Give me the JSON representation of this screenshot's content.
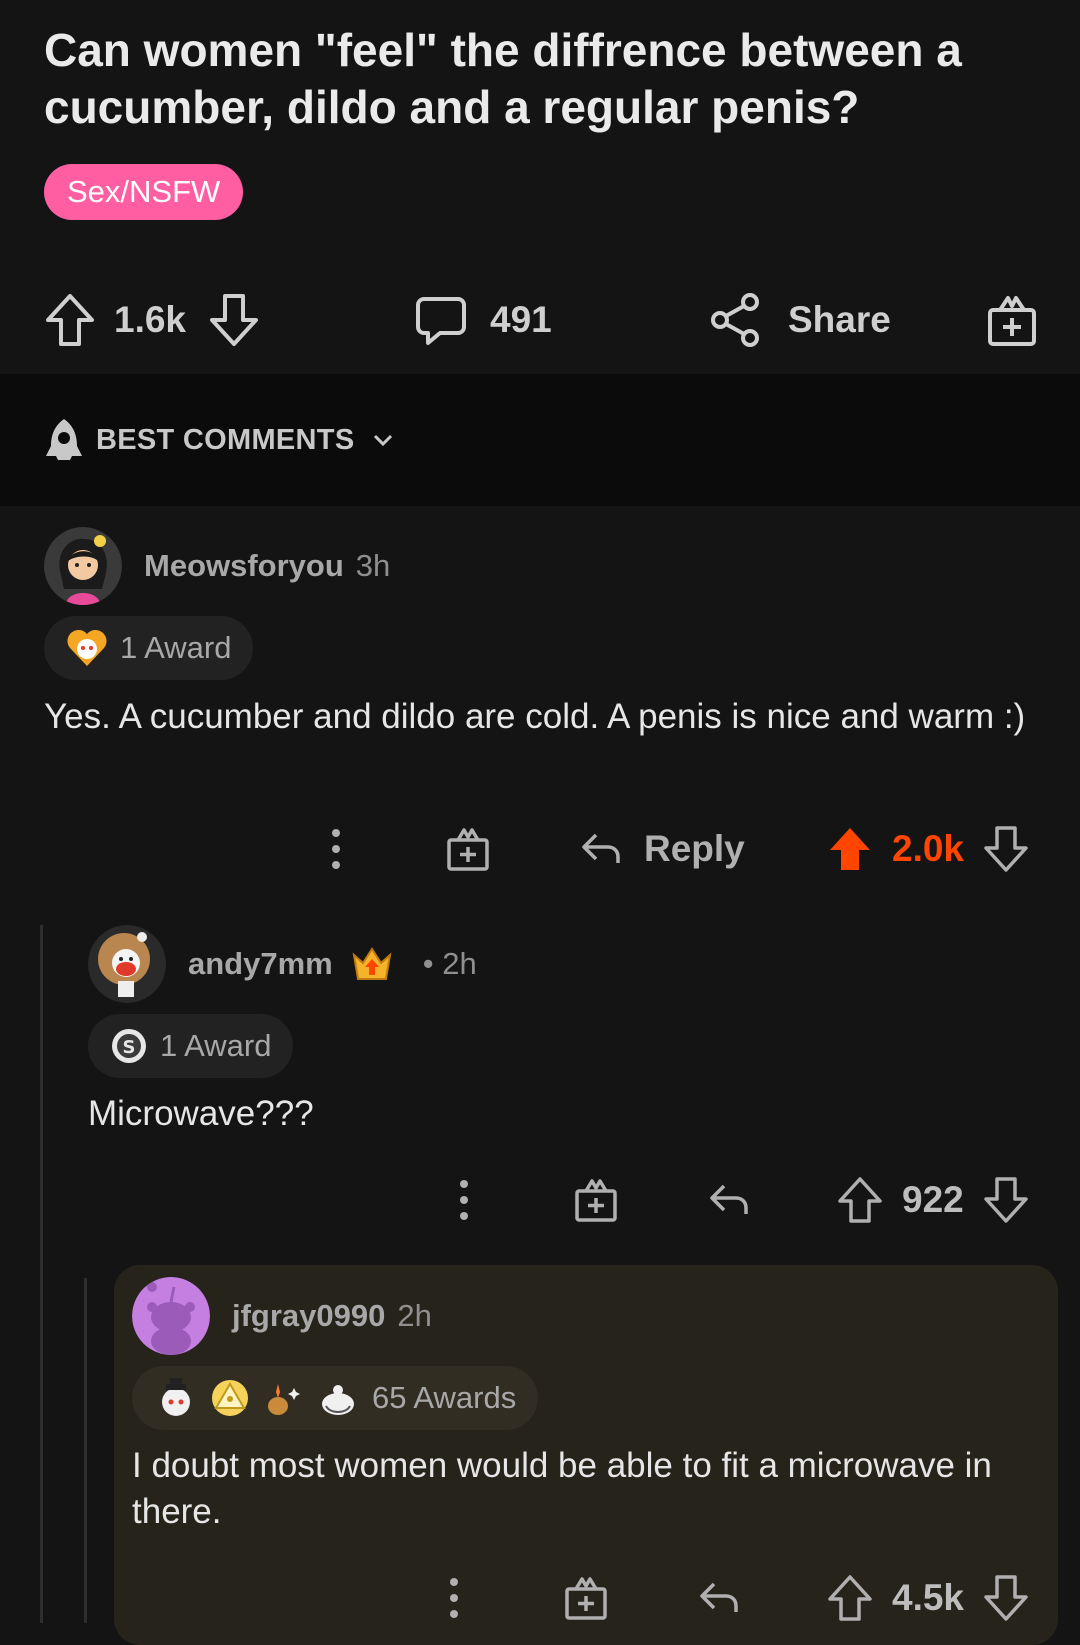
{
  "post": {
    "title": "Can women \"feel\" the diffrence between a cucumber, dildo and a regular penis?",
    "flair": "Sex/NSFW",
    "flair_color": "#ff5fa2",
    "votes": "1.6k",
    "comments": "491",
    "share_label": "Share",
    "icons": [
      "upvote-icon",
      "downvote-icon",
      "comment-icon",
      "share-icon",
      "gift-icon"
    ]
  },
  "sort": {
    "label": "BEST COMMENTS",
    "icon": "rocket-icon"
  },
  "comments": [
    {
      "username": "Meowsforyou",
      "age": "3h",
      "awards": "1 Award",
      "body": "Yes. A cucumber and dildo are cold. A penis is nice and warm :)",
      "reply_label": "Reply",
      "votes": "2.0k",
      "upvoted": true
    },
    {
      "username": "andy7mm",
      "age": "• 2h",
      "awards": "1 Award",
      "body": "Microwave???",
      "votes": "922"
    },
    {
      "username": "jfgray0990",
      "age": "2h",
      "awards": "65 Awards",
      "body": "I doubt most women would be able to fit a microwave in there.",
      "votes": "4.5k"
    }
  ],
  "colors": {
    "upvote_active": "#ff4500",
    "background": "#141414",
    "highlight": "#26231a"
  }
}
